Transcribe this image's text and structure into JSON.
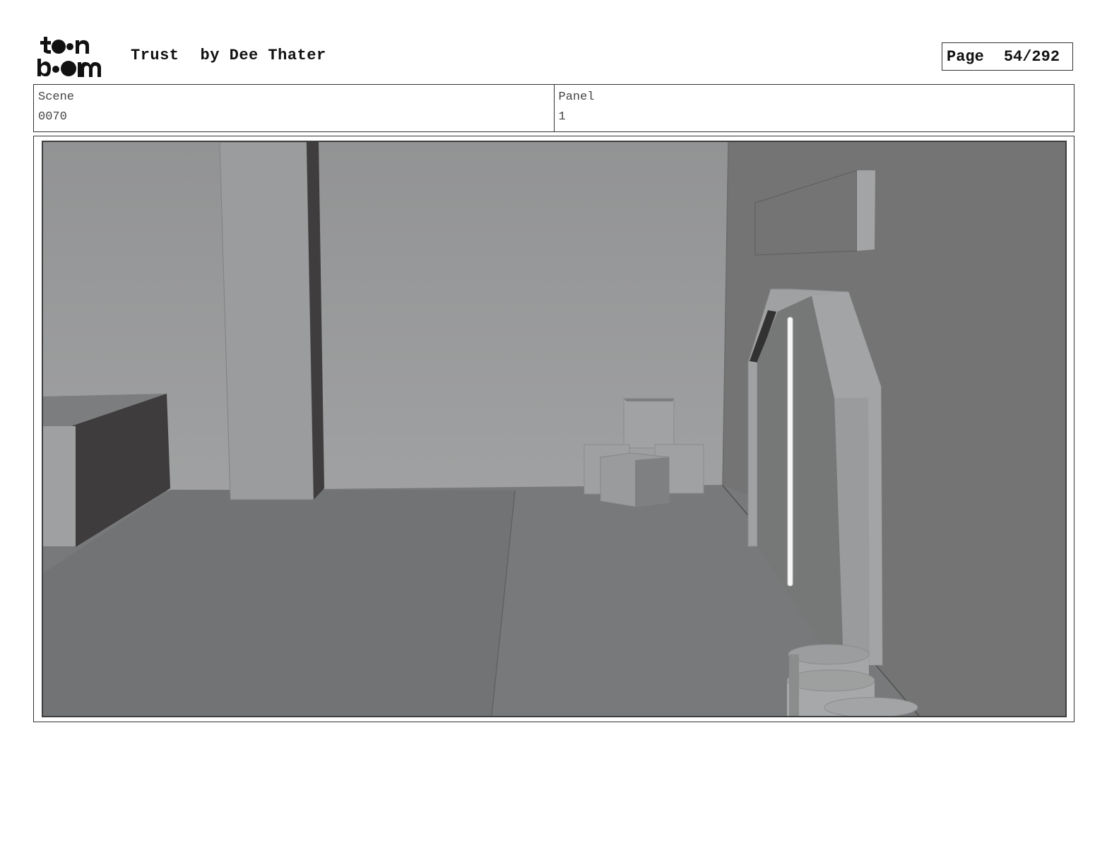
{
  "header": {
    "logo_text": "toonboom",
    "title": "Trust",
    "author": "by Dee Thater",
    "page_label": "Page",
    "page_value": "54/292"
  },
  "info": {
    "scene_label": "Scene",
    "scene_value": "0070",
    "panel_label": "Panel",
    "panel_value": "1"
  },
  "colors": {
    "wall_back": "#9c9d9e",
    "wall_right": "#747574",
    "floor": "#777878",
    "dark_face": "#3d3b3b"
  }
}
